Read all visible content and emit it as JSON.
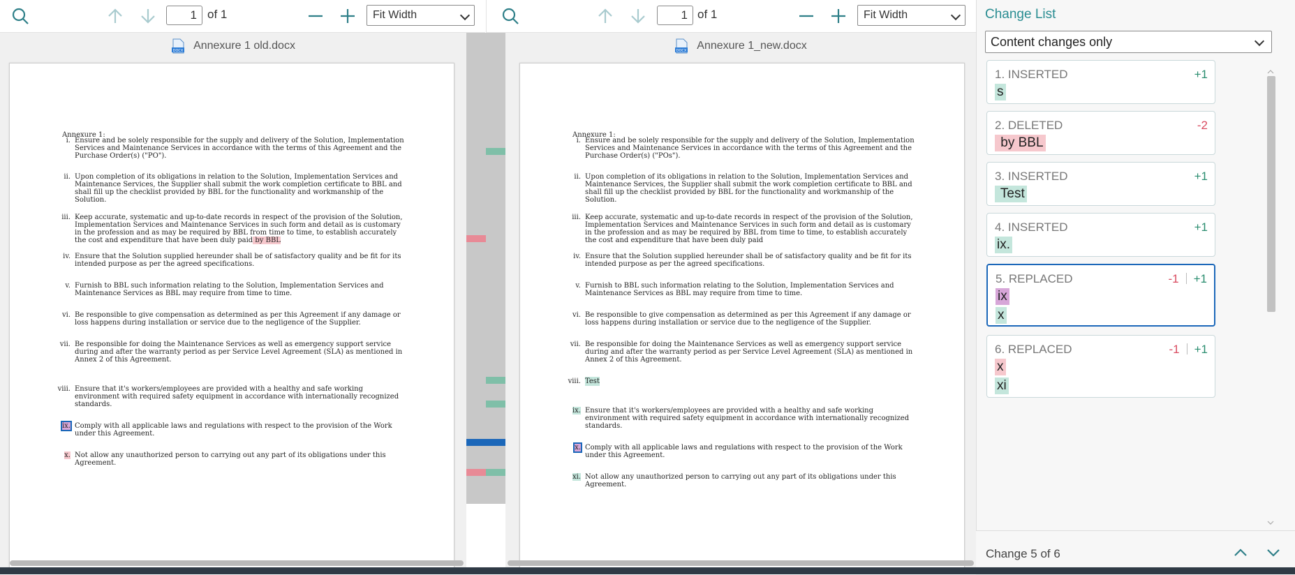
{
  "left_viewer": {
    "page_number": "1",
    "page_total": "of 1",
    "zoom": "Fit Width",
    "filename": "Annexure 1 old.docx",
    "doc_icon_label": "DOCX",
    "heading": "Annexure 1:",
    "items": [
      {
        "num": "i.",
        "lines": [
          "Ensure and be solely responsible for the supply and delivery of the Solution, Implementation",
          "Services and Maintenance Services in accordance with the terms of this Agreement and the",
          "Purchase Order(s) (\"PO\")."
        ]
      },
      {
        "num": "ii.",
        "lines": [
          "Upon completion of its obligations in relation to the Solution, Implementation Services and",
          "Maintenance Services, the Supplier shall submit the work completion certificate to BBL and",
          "shall fill up the checklist provided by BBL for the functionality and workmanship of the",
          "Solution."
        ]
      },
      {
        "num": "iii.",
        "lines": [
          "Keep accurate, systematic and up-to-date records in respect of the provision of the Solution,",
          "Implementation Services and Maintenance Services in such form and detail as is customary",
          "in the profession and as may be required by BBL from time to time, to establish accurately",
          "the cost and expenditure that have been duly paid"
        ],
        "deleted": " by BBL"
      },
      {
        "num": "iv.",
        "lines": [
          "Ensure that the Solution supplied hereunder shall be of satisfactory quality and be fit for its",
          "intended purpose as per the agreed specifications."
        ]
      },
      {
        "num": "v.",
        "lines": [
          "Furnish to BBL such information relating to the Solution, Implementation Services and",
          "Maintenance Services as BBL may require from time to time."
        ]
      },
      {
        "num": "vi.",
        "lines": [
          "Be responsible to give compensation as determined as per this Agreement if any damage or",
          "loss happens during installation or service due to the negligence of the Supplier."
        ]
      },
      {
        "num": "vii.",
        "lines": [
          "Be responsible for doing the Maintenance Services as well as emergency support service",
          "during and after the warranty period as per Service Level Agreement (SLA) as mentioned in",
          "Annex 2 of this Agreement."
        ]
      },
      {
        "num": "viii.",
        "lines": [
          "Ensure that it's workers/employees are provided with a healthy and safe working",
          "environment with required safety equipment in accordance with internationally recognized",
          "standards."
        ]
      },
      {
        "num": "ix.",
        "lines": [
          "Comply with all applicable laws and regulations with respect to the provision of the Work",
          "under this Agreement."
        ]
      },
      {
        "num": "x.",
        "lines": [
          "Not allow any unauthorized person to carrying out any part of its obligations under this",
          "Agreement."
        ]
      }
    ]
  },
  "right_viewer": {
    "page_number": "1",
    "page_total": "of 1",
    "zoom": "Fit Width",
    "filename": "Annexure 1_new.docx",
    "doc_icon_label": "DOCX",
    "heading": "Annexure 1:",
    "items": [
      {
        "num": "i.",
        "lines": [
          "Ensure and be solely responsible for the supply and delivery of the Solution, Implementation",
          "Services and Maintenance Services in accordance with the terms of this Agreement and the",
          "Purchase Order(s) (\"POs\")."
        ]
      },
      {
        "num": "ii.",
        "lines": [
          "Upon completion of its obligations in relation to the Solution, Implementation Services and",
          "Maintenance Services, the Supplier shall submit the work completion certificate to BBL and",
          "shall fill up the checklist provided by BBL for the functionality and workmanship of the",
          "Solution."
        ]
      },
      {
        "num": "iii.",
        "lines": [
          "Keep accurate, systematic and up-to-date records in respect of the provision of the Solution,",
          "Implementation Services and Maintenance Services in such form and detail as is customary",
          "in the profession and as may be required by BBL from time to time, to establish accurately",
          "the cost and expenditure that have been duly paid"
        ]
      },
      {
        "num": "iv.",
        "lines": [
          "Ensure that the Solution supplied hereunder shall be of satisfactory quality and be fit for its",
          "intended purpose as per the agreed specifications."
        ]
      },
      {
        "num": "v.",
        "lines": [
          "Furnish to BBL such information relating to the Solution, Implementation Services and",
          "Maintenance Services as BBL may require from time to time."
        ]
      },
      {
        "num": "vi.",
        "lines": [
          "Be responsible to give compensation as determined as per this Agreement if any damage or",
          "loss happens during installation or service due to the negligence of the Supplier."
        ]
      },
      {
        "num": "vii.",
        "lines": [
          "Be responsible for doing the Maintenance Services as well as emergency support service",
          "during and after the warranty period as per Service Level Agreement (SLA) as mentioned in",
          "Annex 2 of this Agreement."
        ]
      },
      {
        "num": "viii.",
        "lines": [
          "Test"
        ]
      },
      {
        "num": "ix.",
        "lines": [
          "Ensure that it's workers/employees are provided with a healthy and safe working",
          "environment with required safety equipment in accordance with internationally recognized",
          "standards."
        ]
      },
      {
        "num": "x.",
        "lines": [
          "Comply with all applicable laws and regulations with respect to the provision of the Work",
          "under this Agreement."
        ]
      },
      {
        "num": "xi.",
        "lines": [
          "Not allow any unauthorized person to carrying out any part of its obligations under this",
          "Agreement."
        ]
      }
    ]
  },
  "change_list": {
    "title": "Change List",
    "filter": "Content changes only",
    "changes": [
      {
        "header": "1. INSERTED",
        "count_plus": "+1",
        "count_minus": "",
        "inserted": "s",
        "deleted": ""
      },
      {
        "header": "2. DELETED",
        "count_plus": "",
        "count_minus": "-2",
        "inserted": "",
        "deleted": " by BBL"
      },
      {
        "header": "3. INSERTED",
        "count_plus": "+1",
        "count_minus": "",
        "inserted": " Test",
        "deleted": ""
      },
      {
        "header": "4. INSERTED",
        "count_plus": "+1",
        "count_minus": "",
        "inserted": "ix.",
        "deleted": ""
      },
      {
        "header": "5. REPLACED",
        "count_plus": "+1",
        "count_minus": "-1",
        "inserted": "x",
        "deleted": "ix"
      },
      {
        "header": "6. REPLACED",
        "count_plus": "+1",
        "count_minus": "-1",
        "inserted": "xi",
        "deleted": "x"
      }
    ],
    "status": "Change 5 of 6"
  },
  "colors": {
    "accent": "#2a8d92",
    "inserted": "#c4e6dc",
    "deleted": "#f6c8cd",
    "replaced": "#d7a6d8",
    "active_border": "#1b67b9"
  },
  "icons": [
    "search-icon",
    "arrow-up-icon",
    "arrow-down-icon",
    "zoom-out-icon",
    "zoom-in-icon",
    "docx-file-icon",
    "chevron-up-icon",
    "chevron-down-icon"
  ]
}
